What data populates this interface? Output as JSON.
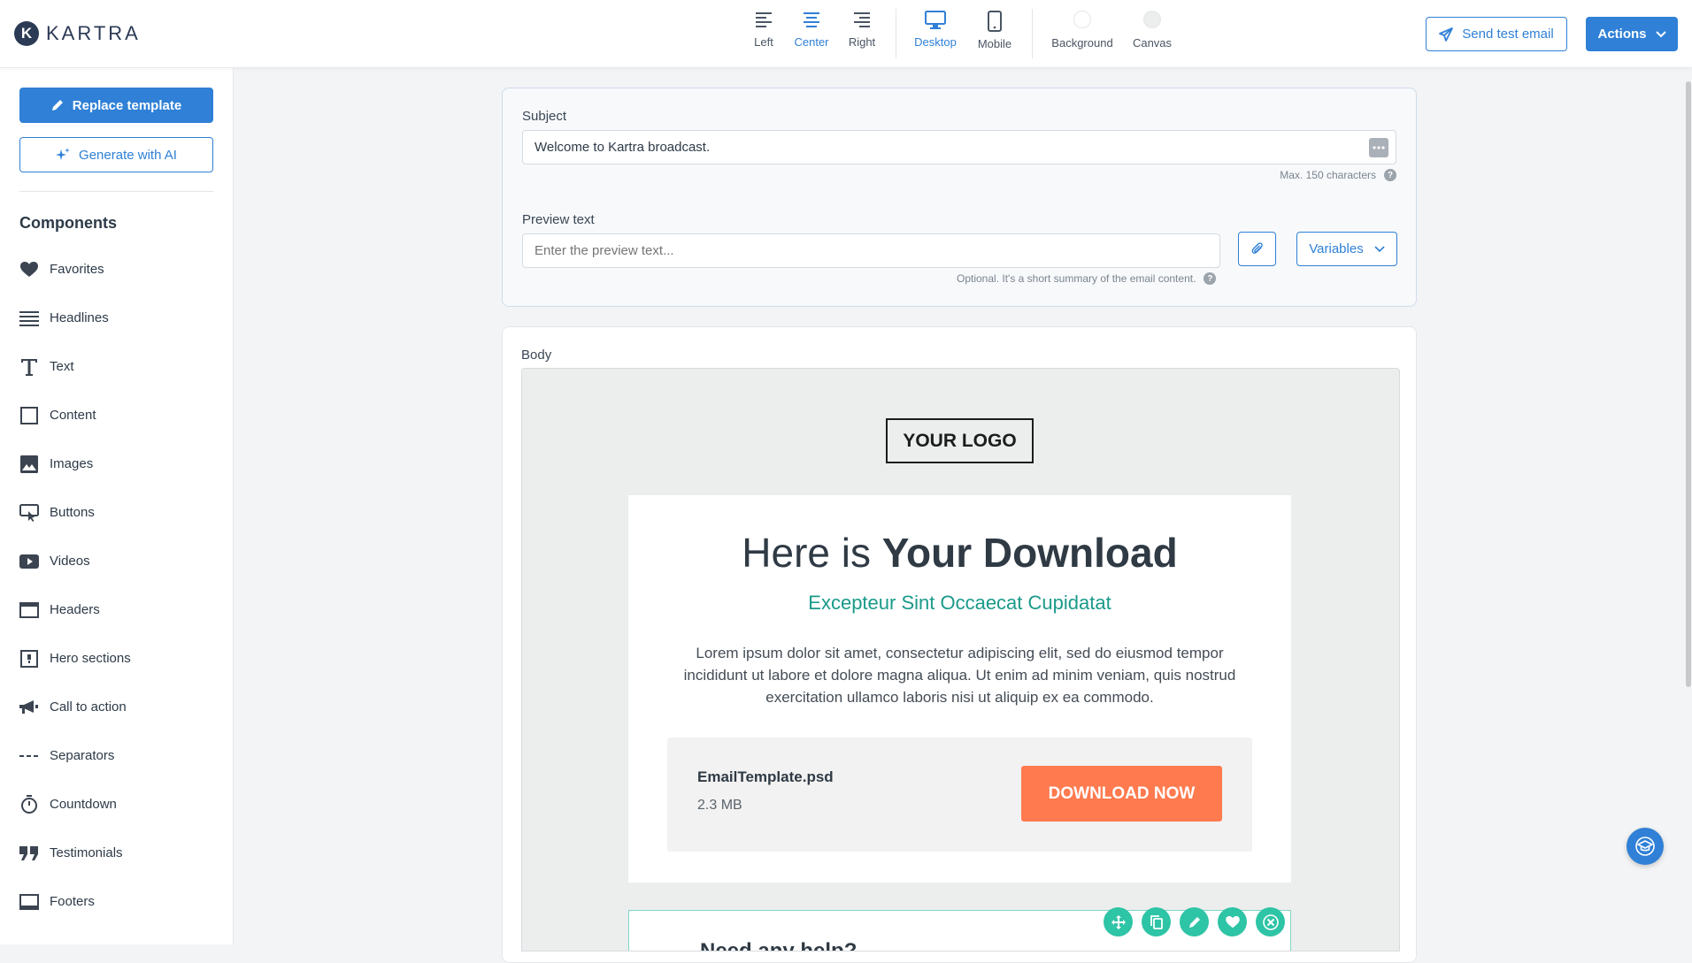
{
  "brand": {
    "name": "KARTRA",
    "mark": "K"
  },
  "toolbar": {
    "align": [
      {
        "label": "Left",
        "active": false
      },
      {
        "label": "Center",
        "active": true
      },
      {
        "label": "Right",
        "active": false
      }
    ],
    "devices": [
      {
        "label": "Desktop",
        "active": true
      },
      {
        "label": "Mobile",
        "active": false
      }
    ],
    "colors": [
      {
        "label": "Background"
      },
      {
        "label": "Canvas"
      }
    ],
    "send_test_label": "Send test email",
    "actions_label": "Actions"
  },
  "sidebar": {
    "replace_label": "Replace template",
    "generate_label": "Generate with AI",
    "components_title": "Components",
    "items": [
      {
        "label": "Favorites",
        "icon": "heart-icon"
      },
      {
        "label": "Headlines",
        "icon": "headlines-icon"
      },
      {
        "label": "Text",
        "icon": "text-icon"
      },
      {
        "label": "Content",
        "icon": "content-icon"
      },
      {
        "label": "Images",
        "icon": "image-icon"
      },
      {
        "label": "Buttons",
        "icon": "button-icon"
      },
      {
        "label": "Videos",
        "icon": "video-icon"
      },
      {
        "label": "Headers",
        "icon": "header-icon"
      },
      {
        "label": "Hero sections",
        "icon": "hero-icon"
      },
      {
        "label": "Call to action",
        "icon": "megaphone-icon"
      },
      {
        "label": "Separators",
        "icon": "separator-icon"
      },
      {
        "label": "Countdown",
        "icon": "stopwatch-icon"
      },
      {
        "label": "Testimonials",
        "icon": "quote-icon"
      },
      {
        "label": "Footers",
        "icon": "footer-icon"
      }
    ]
  },
  "subject": {
    "label": "Subject",
    "value": "Welcome to Kartra broadcast.",
    "hint": "Max. 150 characters"
  },
  "preview": {
    "label": "Preview text",
    "placeholder": "Enter the preview text...",
    "hint": "Optional. It's a short summary of the email content.",
    "variables_label": "Variables"
  },
  "body": {
    "label": "Body",
    "logo_text": "YOUR LOGO",
    "headline_light": "Here is ",
    "headline_bold": "Your Download",
    "subheadline": "Excepteur Sint Occaecat Cupidatat",
    "paragraph": "Lorem ipsum dolor sit amet, consectetur adipiscing elit, sed do eiusmod tempor incididunt ut labore et dolore magna aliqua. Ut enim ad minim veniam, quis nostrud exercitation ullamco laboris nisi ut aliquip ex ea commodo.",
    "file_name": "EmailTemplate.psd",
    "file_size": "2.3 MB",
    "download_label": "DOWNLOAD NOW",
    "next_block_title": "Need any help?"
  },
  "colors": {
    "accent": "#2f80d6",
    "teal": "#1a9a8a",
    "download": "#ff7a4f",
    "block_tools": "#2ec4a6"
  }
}
